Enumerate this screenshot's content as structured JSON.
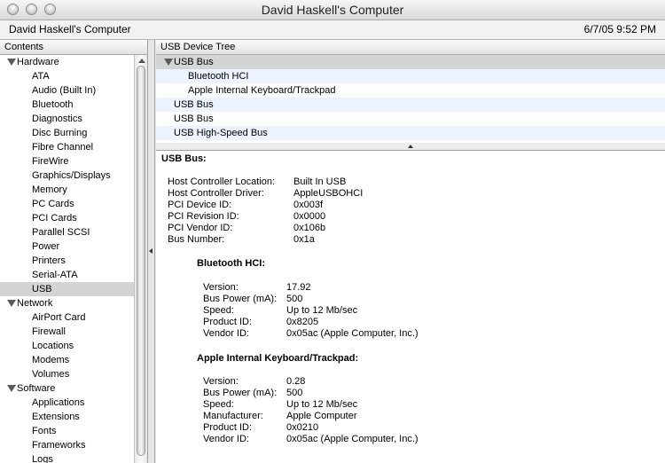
{
  "window": {
    "title": "David Haskell's Computer"
  },
  "header": {
    "computer_name": "David Haskell's Computer",
    "datetime": "6/7/05 9:52 PM"
  },
  "sidebar": {
    "column_title": "Contents",
    "groups": [
      {
        "label": "Hardware",
        "items": [
          "ATA",
          "Audio (Built In)",
          "Bluetooth",
          "Diagnostics",
          "Disc Burning",
          "Fibre Channel",
          "FireWire",
          "Graphics/Displays",
          "Memory",
          "PC Cards",
          "PCI Cards",
          "Parallel SCSI",
          "Power",
          "Printers",
          "Serial-ATA",
          "USB"
        ]
      },
      {
        "label": "Network",
        "items": [
          "AirPort Card",
          "Firewall",
          "Locations",
          "Modems",
          "Volumes"
        ]
      },
      {
        "label": "Software",
        "items": [
          "Applications",
          "Extensions",
          "Fonts",
          "Frameworks",
          "Logs"
        ]
      }
    ],
    "selected": "USB"
  },
  "device_tree": {
    "column_title": "USB Device Tree",
    "rows": [
      {
        "label": "USB Bus",
        "level": 0,
        "expanded": true
      },
      {
        "label": "Bluetooth HCI",
        "level": 1
      },
      {
        "label": "Apple Internal Keyboard/Trackpad",
        "level": 1
      },
      {
        "label": "USB Bus",
        "level": 0
      },
      {
        "label": "USB Bus",
        "level": 0
      },
      {
        "label": "USB High-Speed Bus",
        "level": 0
      }
    ]
  },
  "detail": {
    "title": "USB Bus:",
    "bus_props": [
      {
        "k": "Host Controller Location:",
        "v": "Built In USB"
      },
      {
        "k": "Host Controller Driver:",
        "v": "AppleUSBOHCI"
      },
      {
        "k": "PCI Device ID:",
        "v": "0x003f"
      },
      {
        "k": "PCI Revision ID:",
        "v": "0x0000"
      },
      {
        "k": "PCI Vendor ID:",
        "v": "0x106b"
      },
      {
        "k": "Bus Number:",
        "v": "0x1a"
      }
    ],
    "bluetooth": {
      "title": "Bluetooth HCI:",
      "props": [
        {
          "k": "Version:",
          "v": "17.92"
        },
        {
          "k": "Bus Power (mA):",
          "v": "500"
        },
        {
          "k": "Speed:",
          "v": "Up to 12 Mb/sec"
        },
        {
          "k": "Product ID:",
          "v": "0x8205"
        },
        {
          "k": "Vendor ID:",
          "v": "0x05ac  (Apple Computer, Inc.)"
        }
      ]
    },
    "keyboard": {
      "title": "Apple Internal Keyboard/Trackpad:",
      "props": [
        {
          "k": "Version:",
          "v": "0.28"
        },
        {
          "k": "Bus Power (mA):",
          "v": "500"
        },
        {
          "k": "Speed:",
          "v": "Up to 12 Mb/sec"
        },
        {
          "k": "Manufacturer:",
          "v": "Apple Computer"
        },
        {
          "k": "Product ID:",
          "v": "0x0210"
        },
        {
          "k": "Vendor ID:",
          "v": "0x05ac  (Apple Computer, Inc.)"
        }
      ]
    }
  }
}
